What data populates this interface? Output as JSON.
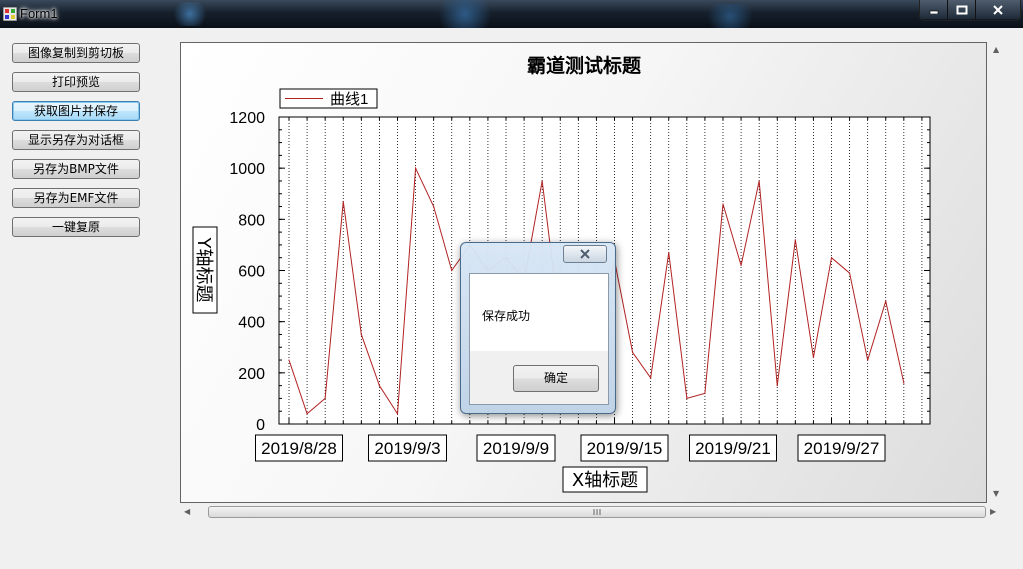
{
  "window": {
    "title": "Form1"
  },
  "buttons": [
    {
      "label": "图像复制到剪切板"
    },
    {
      "label": "打印预览"
    },
    {
      "label": "获取图片并保存"
    },
    {
      "label": "显示另存为对话框"
    },
    {
      "label": "另存为BMP文件"
    },
    {
      "label": "另存为EMF文件"
    },
    {
      "label": "一键复原"
    }
  ],
  "chart_data": {
    "type": "line",
    "title": "霸道测试标题",
    "xlabel": "X轴标题",
    "ylabel": "Y轴标题",
    "ylim": [
      0,
      1200
    ],
    "yticks": [
      "0",
      "200",
      "400",
      "600",
      "800",
      "1000",
      "1200"
    ],
    "x_tick_labels": [
      "2019/8/28",
      "2019/9/3",
      "2019/9/9",
      "2019/9/15",
      "2019/9/21",
      "2019/9/27"
    ],
    "x_dates": [
      "2019/8/28",
      "2019/8/29",
      "2019/8/30",
      "2019/8/31",
      "2019/9/1",
      "2019/9/2",
      "2019/9/3",
      "2019/9/4",
      "2019/9/5",
      "2019/9/6",
      "2019/9/7",
      "2019/9/8",
      "2019/9/9",
      "2019/9/10",
      "2019/9/11",
      "2019/9/12",
      "2019/9/13",
      "2019/9/14",
      "2019/9/15",
      "2019/9/16",
      "2019/9/17",
      "2019/9/18",
      "2019/9/19",
      "2019/9/20",
      "2019/9/21",
      "2019/9/22",
      "2019/9/23",
      "2019/9/24",
      "2019/9/25",
      "2019/9/26",
      "2019/9/27",
      "2019/9/28",
      "2019/9/29",
      "2019/9/30",
      "2019/10/1",
      "2019/10/2"
    ],
    "grid": "vertical dotted",
    "legend_position": "top-left",
    "series": [
      {
        "name": "曲线1",
        "color": "#b22222",
        "values": [
          250,
          40,
          100,
          870,
          350,
          150,
          40,
          1000,
          850,
          600,
          700,
          600,
          650,
          560,
          950,
          380,
          300,
          320,
          640,
          280,
          180,
          670,
          100,
          120,
          860,
          620,
          950,
          150,
          720,
          260,
          650,
          590,
          250,
          480,
          160
        ]
      }
    ]
  },
  "dialog": {
    "message": "保存成功",
    "ok_label": "确定"
  }
}
